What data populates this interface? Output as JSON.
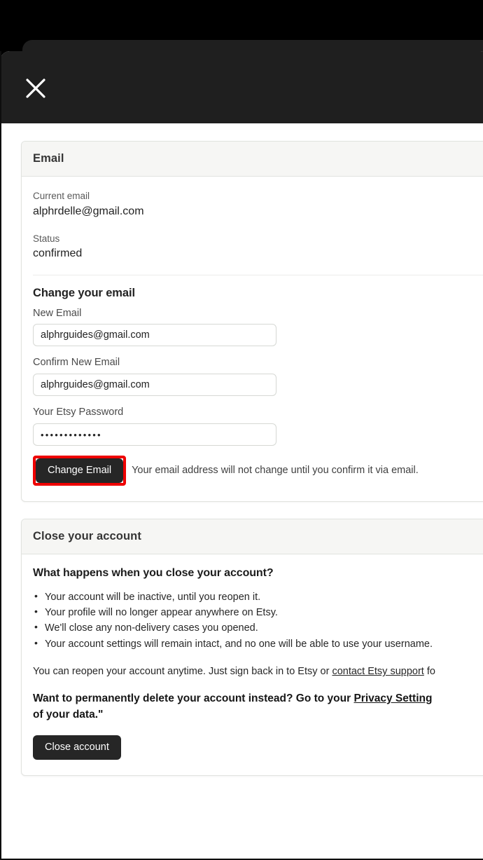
{
  "window": {
    "close_icon": "close-icon"
  },
  "email_card": {
    "header": "Email",
    "current_email_label": "Current email",
    "current_email_value": "alphrdelle@gmail.com",
    "status_label": "Status",
    "status_value": "confirmed",
    "section_title": "Change your email",
    "new_email_label": "New Email",
    "new_email_value": "alphrguides@gmail.com",
    "new_email_placeholder": "",
    "confirm_email_label": "Confirm New Email",
    "confirm_email_value": "alphrguides@gmail.com",
    "confirm_email_placeholder": "",
    "password_label": "Your Etsy Password",
    "password_value": "•••••••••••••",
    "password_placeholder": "",
    "submit_label": "Change Email",
    "helper_text": "Your email address will not change until you confirm it via email.",
    "highlight_color": "#ee0000"
  },
  "close_account_card": {
    "header": "Close your account",
    "question_title": "What happens when you close your account?",
    "bullets": [
      "Your account will be inactive, until you reopen it.",
      "Your profile will no longer appear anywhere on Etsy.",
      "We'll close any non-delivery cases you opened.",
      "Your account settings will remain intact, and no one will be able to use your username."
    ],
    "reopen_text_before": "You can reopen your account anytime. Just sign back in to Etsy or ",
    "reopen_link": "contact Etsy support",
    "reopen_text_after": " fo",
    "delete_line1_before": "Want to permanently delete your account instead? Go to your ",
    "delete_link": "Privacy Setting",
    "delete_line2": "of your data.\"",
    "close_button_label": "Close account"
  }
}
